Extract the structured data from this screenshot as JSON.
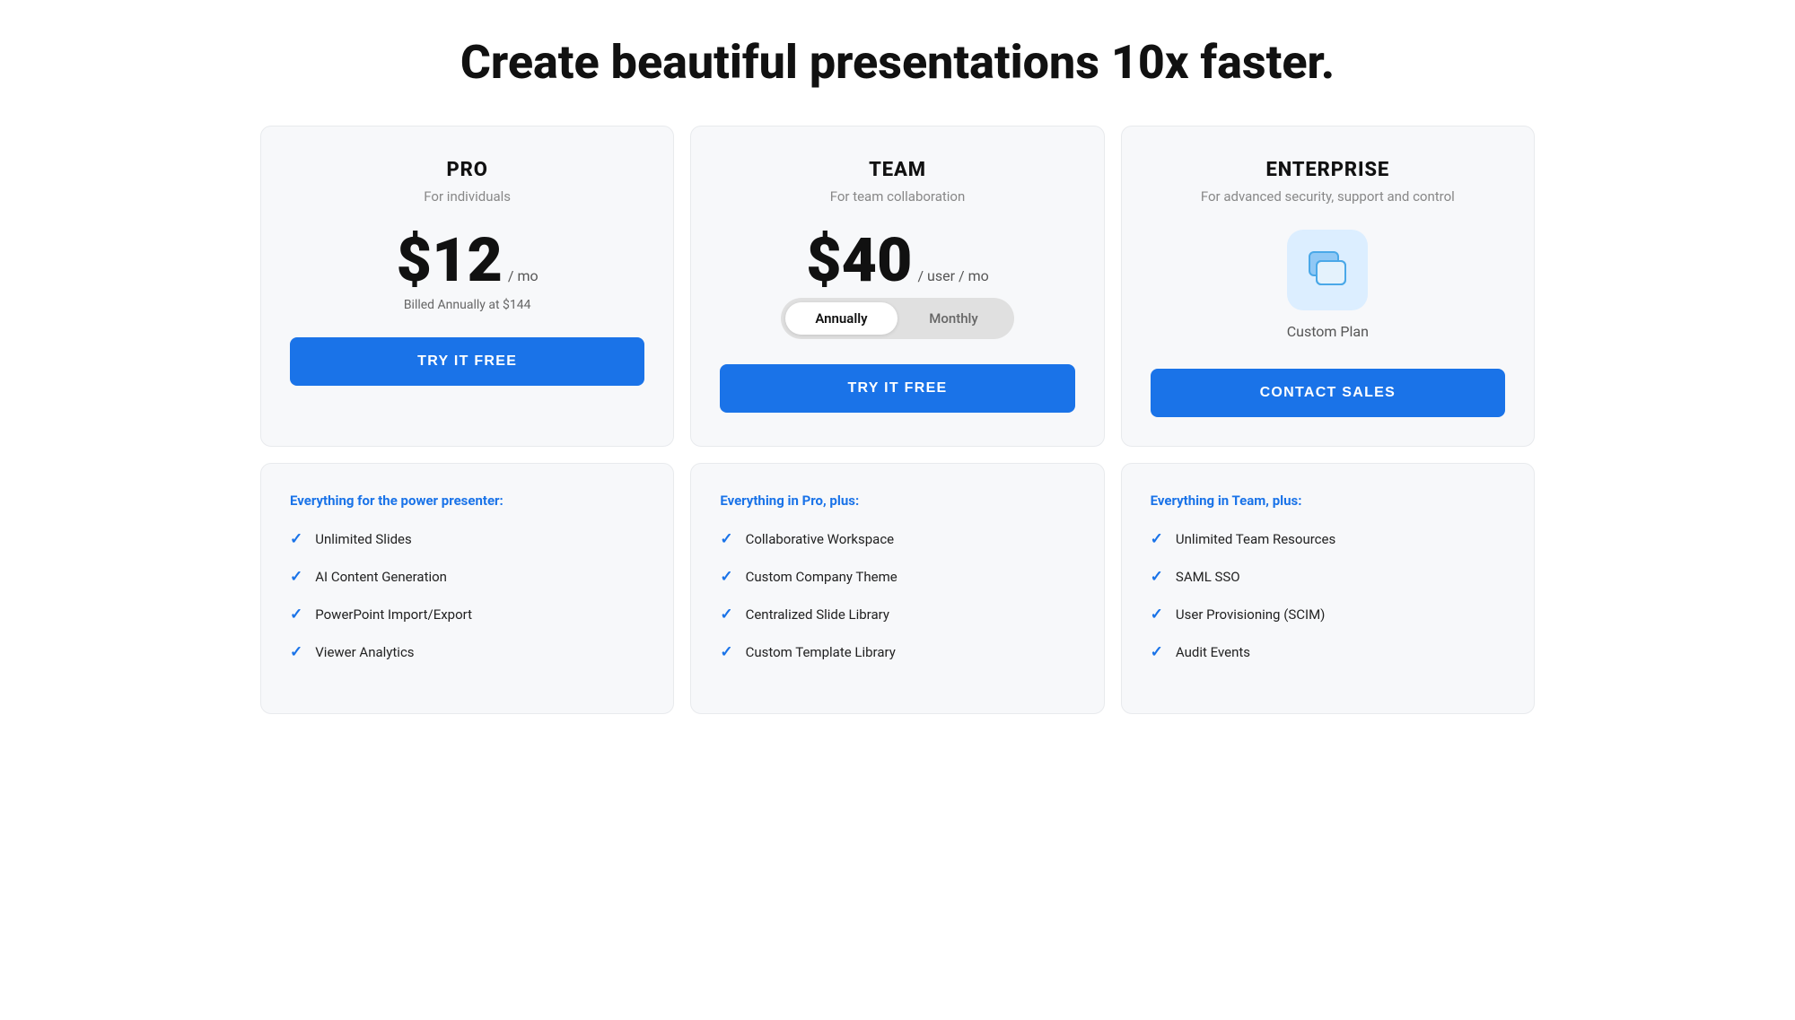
{
  "page": {
    "title": "Create beautiful presentations 10x faster."
  },
  "plans": [
    {
      "id": "pro",
      "name": "PRO",
      "tagline": "For individuals",
      "price_amount": "$12",
      "price_unit": "/ mo",
      "billing_note": "Billed Annually at $144",
      "cta_label": "TRY IT FREE",
      "has_toggle": false,
      "has_enterprise_icon": false,
      "features_heading": "Everything for the power presenter:",
      "features": [
        "Unlimited Slides",
        "AI Content Generation",
        "PowerPoint Import/Export",
        "Viewer Analytics"
      ]
    },
    {
      "id": "team",
      "name": "TEAM",
      "tagline": "For team collaboration",
      "price_amount": "$40",
      "price_unit": "/ user / mo",
      "billing_note": "",
      "cta_label": "TRY IT FREE",
      "has_toggle": true,
      "toggle_options": [
        "Annually",
        "Monthly"
      ],
      "toggle_active": 0,
      "has_enterprise_icon": false,
      "features_heading": "Everything in Pro, plus:",
      "features": [
        "Collaborative Workspace",
        "Custom Company Theme",
        "Centralized Slide Library",
        "Custom Template Library"
      ]
    },
    {
      "id": "enterprise",
      "name": "ENTERPRISE",
      "tagline": "For advanced security, support and control",
      "price_amount": "",
      "price_unit": "",
      "billing_note": "",
      "cta_label": "CONTACT SALES",
      "has_toggle": false,
      "has_enterprise_icon": true,
      "custom_plan_label": "Custom Plan",
      "features_heading": "Everything in Team, plus:",
      "features": [
        "Unlimited Team Resources",
        "SAML SSO",
        "User Provisioning (SCIM)",
        "Audit Events"
      ]
    }
  ]
}
